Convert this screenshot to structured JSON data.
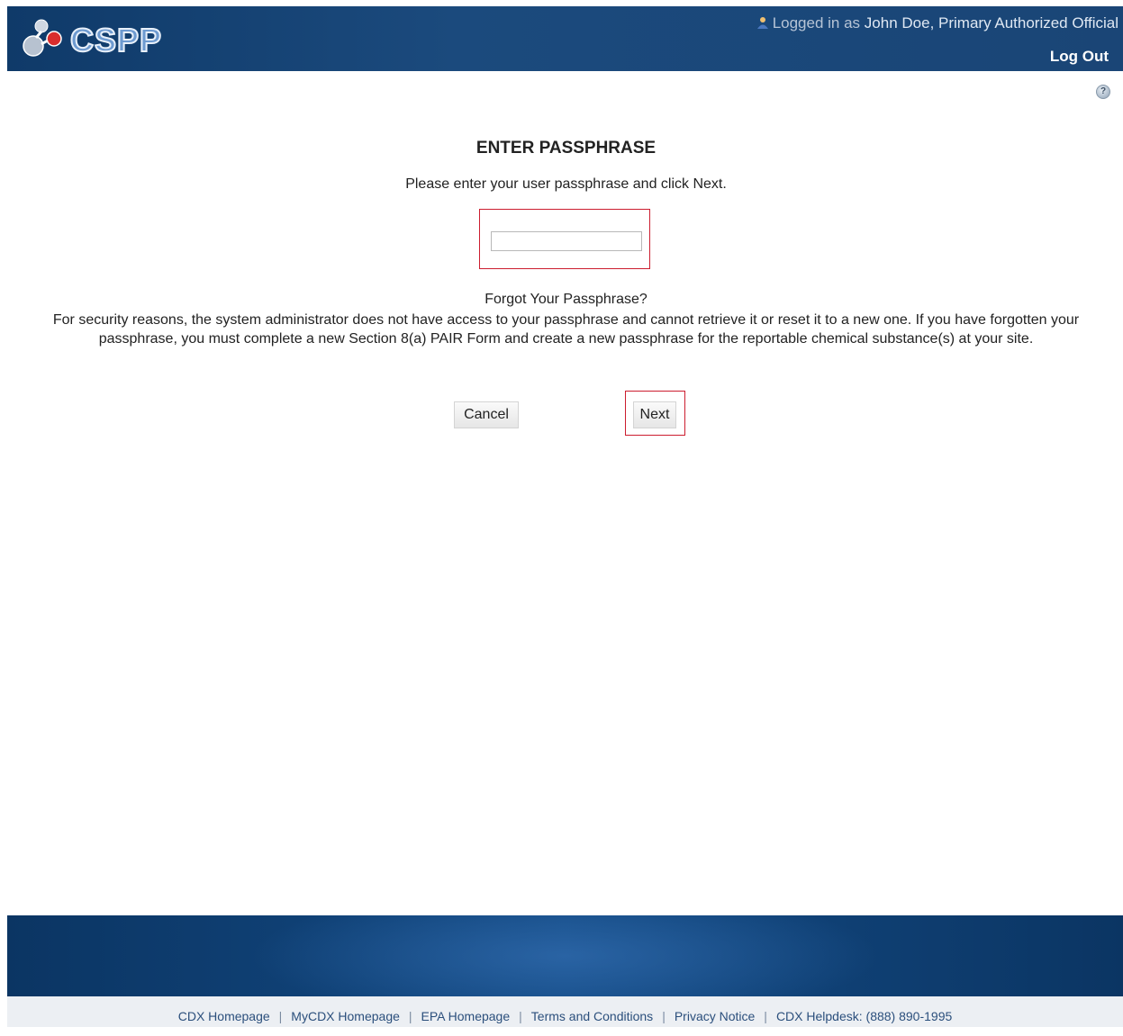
{
  "header": {
    "app_name": "CSPP",
    "logged_in_prefix": "Logged in as",
    "user_name": "John Doe, Primary Authorized Official",
    "logout_label": "Log Out"
  },
  "main": {
    "title": "ENTER PASSPHRASE",
    "instruction": "Please enter your user passphrase and click Next.",
    "passphrase_value": "",
    "forgot_title": "Forgot Your Passphrase?",
    "forgot_body": "For security reasons, the system administrator does not have access to your passphrase and cannot retrieve it or reset it to a new one. If you have forgotten your passphrase, you must complete a new Section 8(a) PAIR Form and create a new passphrase for the reportable chemical substance(s) at your site.",
    "cancel_label": "Cancel",
    "next_label": "Next"
  },
  "footer": {
    "links": [
      "CDX Homepage",
      "MyCDX Homepage",
      "EPA Homepage",
      "Terms and Conditions",
      "Privacy Notice"
    ],
    "helpdesk": "CDX Helpdesk: (888) 890-1995"
  },
  "colors": {
    "header_bg": "#1b4a7d",
    "highlight_border": "#cc1d2f",
    "link": "#2b4f7c"
  },
  "icons": [
    "molecule-logo-icon",
    "user-icon",
    "help-icon"
  ]
}
